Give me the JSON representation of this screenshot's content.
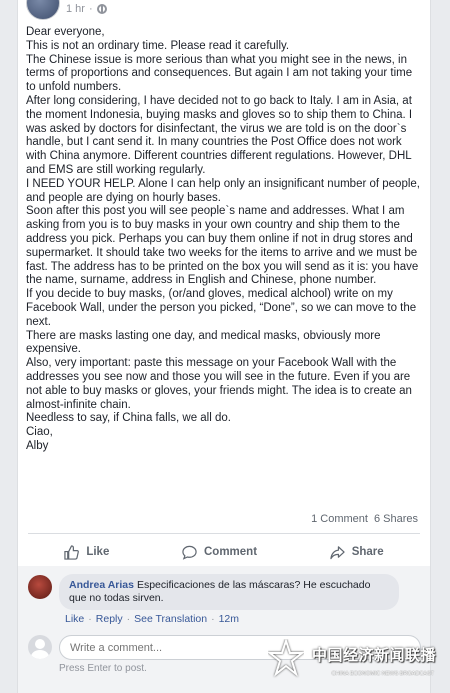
{
  "post": {
    "time": "1 hr",
    "dot": "·",
    "paragraphs": [
      "Dear everyone,",
      "This is not an ordinary time. Please read it carefully.",
      "The Chinese issue is more serious than what you might see in the news, in terms of proportions and consequences. But again I am not taking your time to unfold numbers.",
      "After long considering, I have decided not to go back to Italy. I am in Asia, at the moment Indonesia, buying masks and gloves so to ship them to China. I was asked by doctors for disinfectant, the virus we are told is on the door`s handle, but I cant send it. In many countries the Post Office does not work with China anymore. Different countries different regulations. However, DHL and EMS are still working regularly.",
      "I NEED YOUR HELP. Alone I can help only an insignificant number of people, and people are dying on hourly bases.",
      "Soon after this post you will see people`s name and addresses. What I am asking from you is to buy masks in your own country and ship them to the address you pick. Perhaps you can buy them online if not in drug stores and supermarket. It should take two weeks for the items to arrive and we must be fast. The address has to be printed on the box you will send as it is: you have the name, surname, address in English and Chinese, phone number.",
      "If you decide to buy masks,    (or/and gloves, medical alchool)    write on my Facebook Wall, under the person you picked, “Done”, so we can move to the next.",
      "There are masks lasting one day, and medical masks, obviously more expensive.",
      "Also, very important: paste this message on your Facebook Wall with the addresses you see now and those you will see in the future. Even if you are not able to buy masks or gloves, your friends might. The idea is to create an almost-infinite chain.",
      "Needless to say, if China falls, we all do.",
      "Ciao,",
      "Alby"
    ],
    "comments_count": "1 Comment",
    "shares_count": "6 Shares"
  },
  "actions": {
    "like": "Like",
    "comment": "Comment",
    "share": "Share"
  },
  "comment": {
    "author": "Andrea Arias",
    "text": "Especificaciones de las máscaras? He escuchado que no todas sirven.",
    "like": "Like",
    "reply": "Reply",
    "see_translation": "See Translation",
    "time": "12m",
    "sep": "·"
  },
  "composer": {
    "placeholder": "Write a comment...",
    "hint": "Press Enter to post."
  },
  "watermark": {
    "text": "中国经济新闻联播",
    "sub": "CHINA ECONOMIC NEWS BROADCAST"
  },
  "colors": {
    "link": "#385898",
    "meta": "#90949c",
    "text": "#1d2129"
  }
}
